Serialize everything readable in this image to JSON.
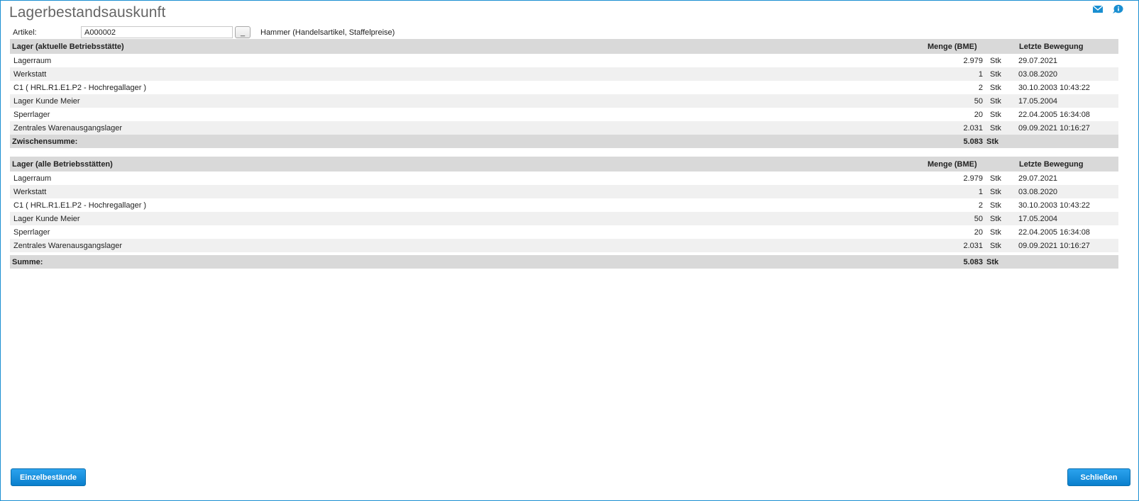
{
  "window": {
    "title": "Lagerbestandsauskunft"
  },
  "article": {
    "label": "Artikel:",
    "value": "A000002",
    "lookup_label": "_",
    "description": "Hammer (Handelsartikel, Staffelpreise)"
  },
  "table_current": {
    "header": {
      "name": "Lager (aktuelle Betriebsstätte)",
      "quantity": "Menge (BME)",
      "last_movement": "Letzte Bewegung"
    },
    "rows": [
      {
        "name": "Lagerraum",
        "qty": "2.979",
        "unit": "Stk",
        "date": "29.07.2021"
      },
      {
        "name": "Werkstatt",
        "qty": "1",
        "unit": "Stk",
        "date": "03.08.2020"
      },
      {
        "name": "C1 ( HRL.R1.E1.P2 - Hochregallager )",
        "qty": "2",
        "unit": "Stk",
        "date": "30.10.2003 10:43:22"
      },
      {
        "name": "Lager Kunde Meier",
        "qty": "50",
        "unit": "Stk",
        "date": "17.05.2004"
      },
      {
        "name": "Sperrlager",
        "qty": "20",
        "unit": "Stk",
        "date": "22.04.2005 16:34:08"
      },
      {
        "name": "Zentrales Warenausgangslager",
        "qty": "2.031",
        "unit": "Stk",
        "date": "09.09.2021 10:16:27"
      }
    ],
    "total": {
      "label": "Zwischensumme:",
      "qty": "5.083",
      "unit": "Stk"
    }
  },
  "table_all": {
    "header": {
      "name": "Lager (alle Betriebsstätten)",
      "quantity": "Menge (BME)",
      "last_movement": "Letzte Bewegung"
    },
    "rows": [
      {
        "name": "Lagerraum",
        "qty": "2.979",
        "unit": "Stk",
        "date": "29.07.2021"
      },
      {
        "name": "Werkstatt",
        "qty": "1",
        "unit": "Stk",
        "date": "03.08.2020"
      },
      {
        "name": "C1 ( HRL.R1.E1.P2 - Hochregallager )",
        "qty": "2",
        "unit": "Stk",
        "date": "30.10.2003 10:43:22"
      },
      {
        "name": "Lager Kunde Meier",
        "qty": "50",
        "unit": "Stk",
        "date": "17.05.2004"
      },
      {
        "name": "Sperrlager",
        "qty": "20",
        "unit": "Stk",
        "date": "22.04.2005 16:34:08"
      },
      {
        "name": "Zentrales Warenausgangslager",
        "qty": "2.031",
        "unit": "Stk",
        "date": "09.09.2021 10:16:27"
      }
    ],
    "total": {
      "label": "Summe:",
      "qty": "5.083",
      "unit": "Stk"
    }
  },
  "footer": {
    "details_button": "Einzelbestände",
    "close_button": "Schließen"
  },
  "icons": {
    "mail": "mail-icon",
    "help": "help-bubble-icon",
    "accent_color": "#1a8fd1"
  }
}
